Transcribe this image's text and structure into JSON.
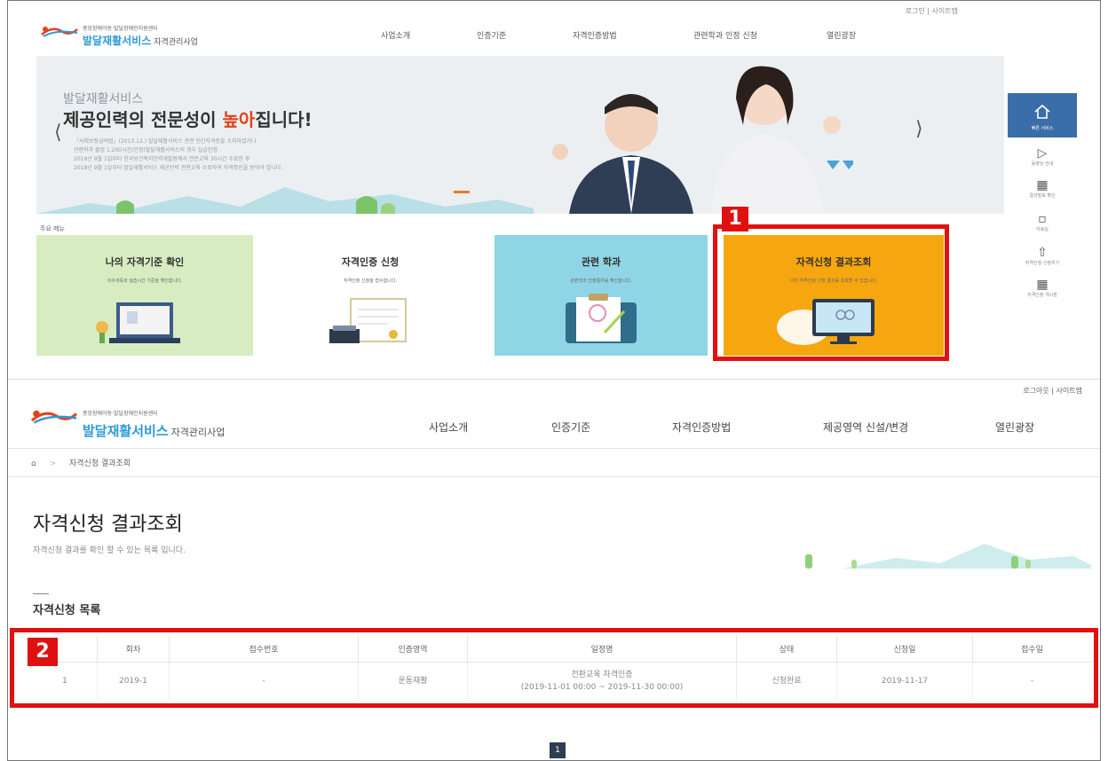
{
  "top": {
    "util": "로그인 | 사이트맵",
    "logo": {
      "tiny": "중앙장애아동·발달장애인지원센터",
      "main": "발달재활서비스",
      "sub": "자격관리사업"
    },
    "nav": [
      "사업소개",
      "인증기준",
      "자격인증방법",
      "관련학과 인정 신청",
      "열린광장"
    ]
  },
  "banner": {
    "subtitle": "발달재활서비스",
    "title_pre": "제공인력의 전문성이 ",
    "title_hl": "높아",
    "title_post": "집니다!",
    "lines": [
      "「사회보장급여법」(2013.12.) 발달재활서비스 관련 민간자격증을 소지하였거나",
      "관련학과 졸업 1,200시간(인정)발달재활서비스의 경우 실습인정",
      "2016년 9월 1일부터 한국보건복지인력개발원에서 전문교육 30시간 수료한 후",
      "2018년 9월 1일부터 발달재활서비스 제공인력 관련교육 수료하여 자격확인을 받아야 합니다."
    ]
  },
  "quick": {
    "top_label": "빠른 서비스",
    "items": [
      {
        "icon": "play-icon",
        "label": "동영상 안내"
      },
      {
        "icon": "calendar-icon",
        "label": "결과발표 확인"
      },
      {
        "icon": "folder-icon",
        "label": "자료실"
      },
      {
        "icon": "upload-icon",
        "label": "자격인정 신청하기"
      },
      {
        "icon": "board-icon",
        "label": "자격인정 게시판"
      }
    ]
  },
  "main_menu": {
    "label": "주요 메뉴",
    "tiles": [
      {
        "title": "나의 자격기준 확인",
        "desc": "이수과목과 실습시간 기준을 확인합니다.",
        "color": "#d7edc1"
      },
      {
        "title": "자격인증 신청",
        "desc": "자격인정 신청을 접수합니다.",
        "color": "#ffffff"
      },
      {
        "title": "관련 학과",
        "desc": "관련학과 인정절차를 확인합니다.",
        "color": "#8fd5e6"
      },
      {
        "title": "자격신청 결과조회",
        "desc": "나의 자격인정 신청 결과를 조회할 수 있습니다.",
        "color": "#f6a60e"
      }
    ]
  },
  "badges": {
    "one": "1",
    "two": "2"
  },
  "bottom": {
    "util": "로그아웃 | 사이트맵",
    "logo": {
      "tiny": "중앙장애아동·발달장애인지원센터",
      "main": "발달재활서비스",
      "sub": "자격관리사업"
    },
    "nav": [
      "사업소개",
      "인증기준",
      "자격인증방법",
      "제공영역 신설/변경",
      "열린광장"
    ],
    "breadcrumb": "자격신청 결과조회",
    "page_title": "자격신청 결과조회",
    "page_desc": "자격신청 결과를 확인 할 수 있는 목록 입니다.",
    "section_title": "자격신청 목록",
    "table": {
      "headers": [
        "",
        "회차",
        "접수번호",
        "인증영역",
        "일정명",
        "상태",
        "신청일",
        "접수일"
      ],
      "rows": [
        [
          "1",
          "2019-1",
          "-",
          "운동재활",
          "전환교육 자격인증",
          "(2019-11-01 00:00 ~ 2019-11-30 00:00)",
          "신청완료",
          "2019-11-17",
          "-"
        ]
      ]
    },
    "pager": "1"
  },
  "colors": {
    "accent_red": "#e21010",
    "brand_blue": "#2b9bd6",
    "nav_dark": "#2c3e50"
  }
}
